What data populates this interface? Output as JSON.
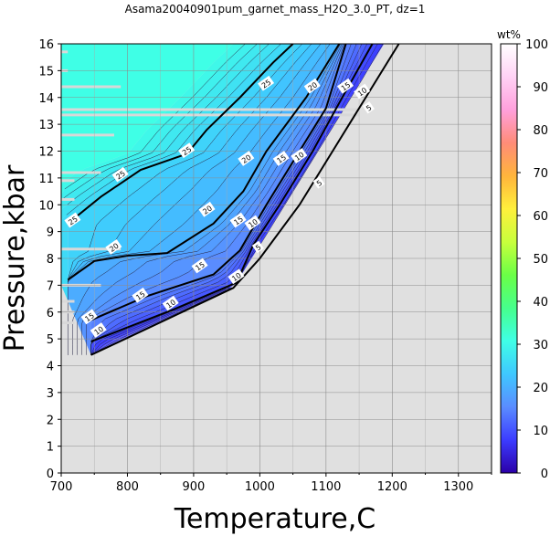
{
  "chart_data": {
    "type": "contour",
    "title": "Asama20040901pum_garnet_mass_H2O_3.0_PT, dz=1",
    "xlabel": "Temperature,C",
    "ylabel": "Pressure,kbar",
    "xlim": [
      700,
      1350
    ],
    "ylim": [
      0,
      16
    ],
    "xticks": [
      700,
      800,
      900,
      1000,
      1100,
      1200,
      1300
    ],
    "yticks": [
      0,
      1,
      2,
      3,
      4,
      5,
      6,
      7,
      8,
      9,
      10,
      11,
      12,
      13,
      14,
      15,
      16
    ],
    "grid": true,
    "colorbar": {
      "label": "wt%",
      "range": [
        0,
        100
      ],
      "ticks": [
        0,
        10,
        20,
        30,
        40,
        50,
        60,
        70,
        80,
        90,
        100
      ],
      "colors": [
        "#2b00a8",
        "#3c3cff",
        "#5a8cff",
        "#3fc8ff",
        "#3fffe6",
        "#46ff8c",
        "#6bff46",
        "#c8ff3c",
        "#fff03c",
        "#ffb43c",
        "#ff8c78",
        "#ffa0dc",
        "#ffd2f5",
        "#ffffff"
      ]
    },
    "field_color_ramp": [
      "#d9d9ff",
      "#3c3cff",
      "#5a8cff",
      "#3fc8ff",
      "#3fffe6"
    ],
    "no_data_color": "#e0e0e0",
    "contour_labels": [
      5,
      10,
      15,
      20,
      25
    ],
    "labeled_contours": [
      {
        "level": 5,
        "points": [
          [
            745,
            4.4
          ],
          [
            960,
            6.9
          ],
          [
            1000,
            8.0
          ],
          [
            1060,
            10.0
          ],
          [
            1110,
            12.0
          ],
          [
            1160,
            14.0
          ],
          [
            1210,
            16.0
          ]
        ],
        "labels": [
          [
            998,
            8.4
          ],
          [
            1090,
            10.8
          ],
          [
            1165,
            13.6
          ]
        ]
      },
      {
        "level": 10,
        "points": [
          [
            745,
            4.9
          ],
          [
            870,
            6.1
          ],
          [
            965,
            7.1
          ],
          [
            990,
            8.5
          ],
          [
            1030,
            10.0
          ],
          [
            1080,
            12.0
          ],
          [
            1120,
            13.8
          ],
          [
            1170,
            16.0
          ]
        ],
        "labels": [
          [
            757,
            5.3
          ],
          [
            866,
            6.3
          ],
          [
            965,
            7.3
          ],
          [
            990,
            9.3
          ],
          [
            1060,
            11.8
          ],
          [
            1155,
            14.2
          ]
        ]
      },
      {
        "level": 15,
        "points": [
          [
            745,
            5.7
          ],
          [
            830,
            6.6
          ],
          [
            930,
            7.4
          ],
          [
            970,
            8.3
          ],
          [
            1010,
            10.0
          ],
          [
            1060,
            12.0
          ],
          [
            1100,
            13.6
          ],
          [
            1130,
            16.0
          ]
        ],
        "labels": [
          [
            743,
            5.8
          ],
          [
            820,
            6.6
          ],
          [
            910,
            7.7
          ],
          [
            968,
            9.4
          ],
          [
            1033,
            11.7
          ],
          [
            1130,
            14.4
          ]
        ]
      },
      {
        "level": 20,
        "points": [
          [
            710,
            7.2
          ],
          [
            750,
            7.9
          ],
          [
            800,
            8.1
          ],
          [
            860,
            8.2
          ],
          [
            930,
            9.3
          ],
          [
            975,
            10.5
          ],
          [
            1010,
            12.0
          ],
          [
            1070,
            14.0
          ],
          [
            1120,
            16.0
          ]
        ],
        "labels": [
          [
            780,
            8.4
          ],
          [
            921,
            9.8
          ],
          [
            980,
            11.7
          ],
          [
            1080,
            14.4
          ]
        ]
      },
      {
        "level": 25,
        "points": [
          [
            710,
            9.3
          ],
          [
            760,
            10.3
          ],
          [
            820,
            11.3
          ],
          [
            890,
            11.9
          ],
          [
            920,
            12.8
          ],
          [
            970,
            14.0
          ],
          [
            1020,
            15.3
          ],
          [
            1050,
            16.0
          ]
        ],
        "labels": [
          [
            718,
            9.4
          ],
          [
            790,
            11.1
          ],
          [
            890,
            12.0
          ],
          [
            1010,
            14.5
          ]
        ]
      }
    ]
  }
}
